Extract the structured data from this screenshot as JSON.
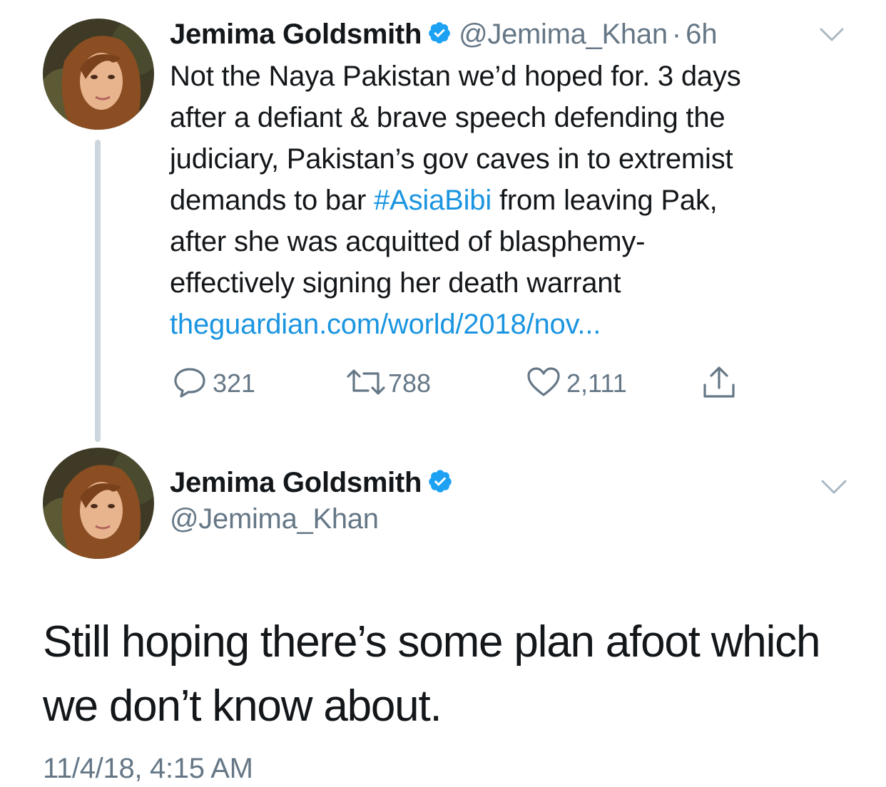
{
  "colors": {
    "text": "#14171a",
    "secondary": "#657786",
    "link": "#1b95e0",
    "verified": "#1da1f2",
    "thread_line": "#ccd6dd"
  },
  "reply_tweet": {
    "author_name": "Jemima Goldsmith",
    "verified_icon": "verified-badge-icon",
    "handle": "@Jemima_Khan",
    "separator": "·",
    "time_ago": "6h",
    "menu_icon": "chevron-down-icon",
    "text_lines": [
      "Not the Naya Pakistan we’d hoped for. 3 days",
      "after a defiant & brave speech defending the",
      "judiciary, Pakistan’s gov caves in to extremist"
    ],
    "line4_before": "demands to bar ",
    "hashtag": "#AsiaBibi",
    "line4_after": " from leaving Pak,",
    "text_lines_end": [
      "after she was acquitted of blasphemy-",
      "effectively signing her death warrant"
    ],
    "link_text": "theguardian.com/world/2018/nov...",
    "actions": {
      "reply": {
        "icon": "reply-icon",
        "count": "321"
      },
      "retweet": {
        "icon": "retweet-icon",
        "count": "788"
      },
      "like": {
        "icon": "heart-icon",
        "count": "2,111"
      },
      "share": {
        "icon": "share-icon"
      }
    }
  },
  "main_tweet": {
    "author_name": "Jemima Goldsmith",
    "verified_icon": "verified-badge-icon",
    "handle": "@Jemima_Khan",
    "menu_icon": "chevron-down-icon",
    "text_line1": "Still hoping there’s some plan afoot which",
    "text_line2": "we don’t know about.",
    "timestamp": "11/4/18, 4:15 AM"
  }
}
